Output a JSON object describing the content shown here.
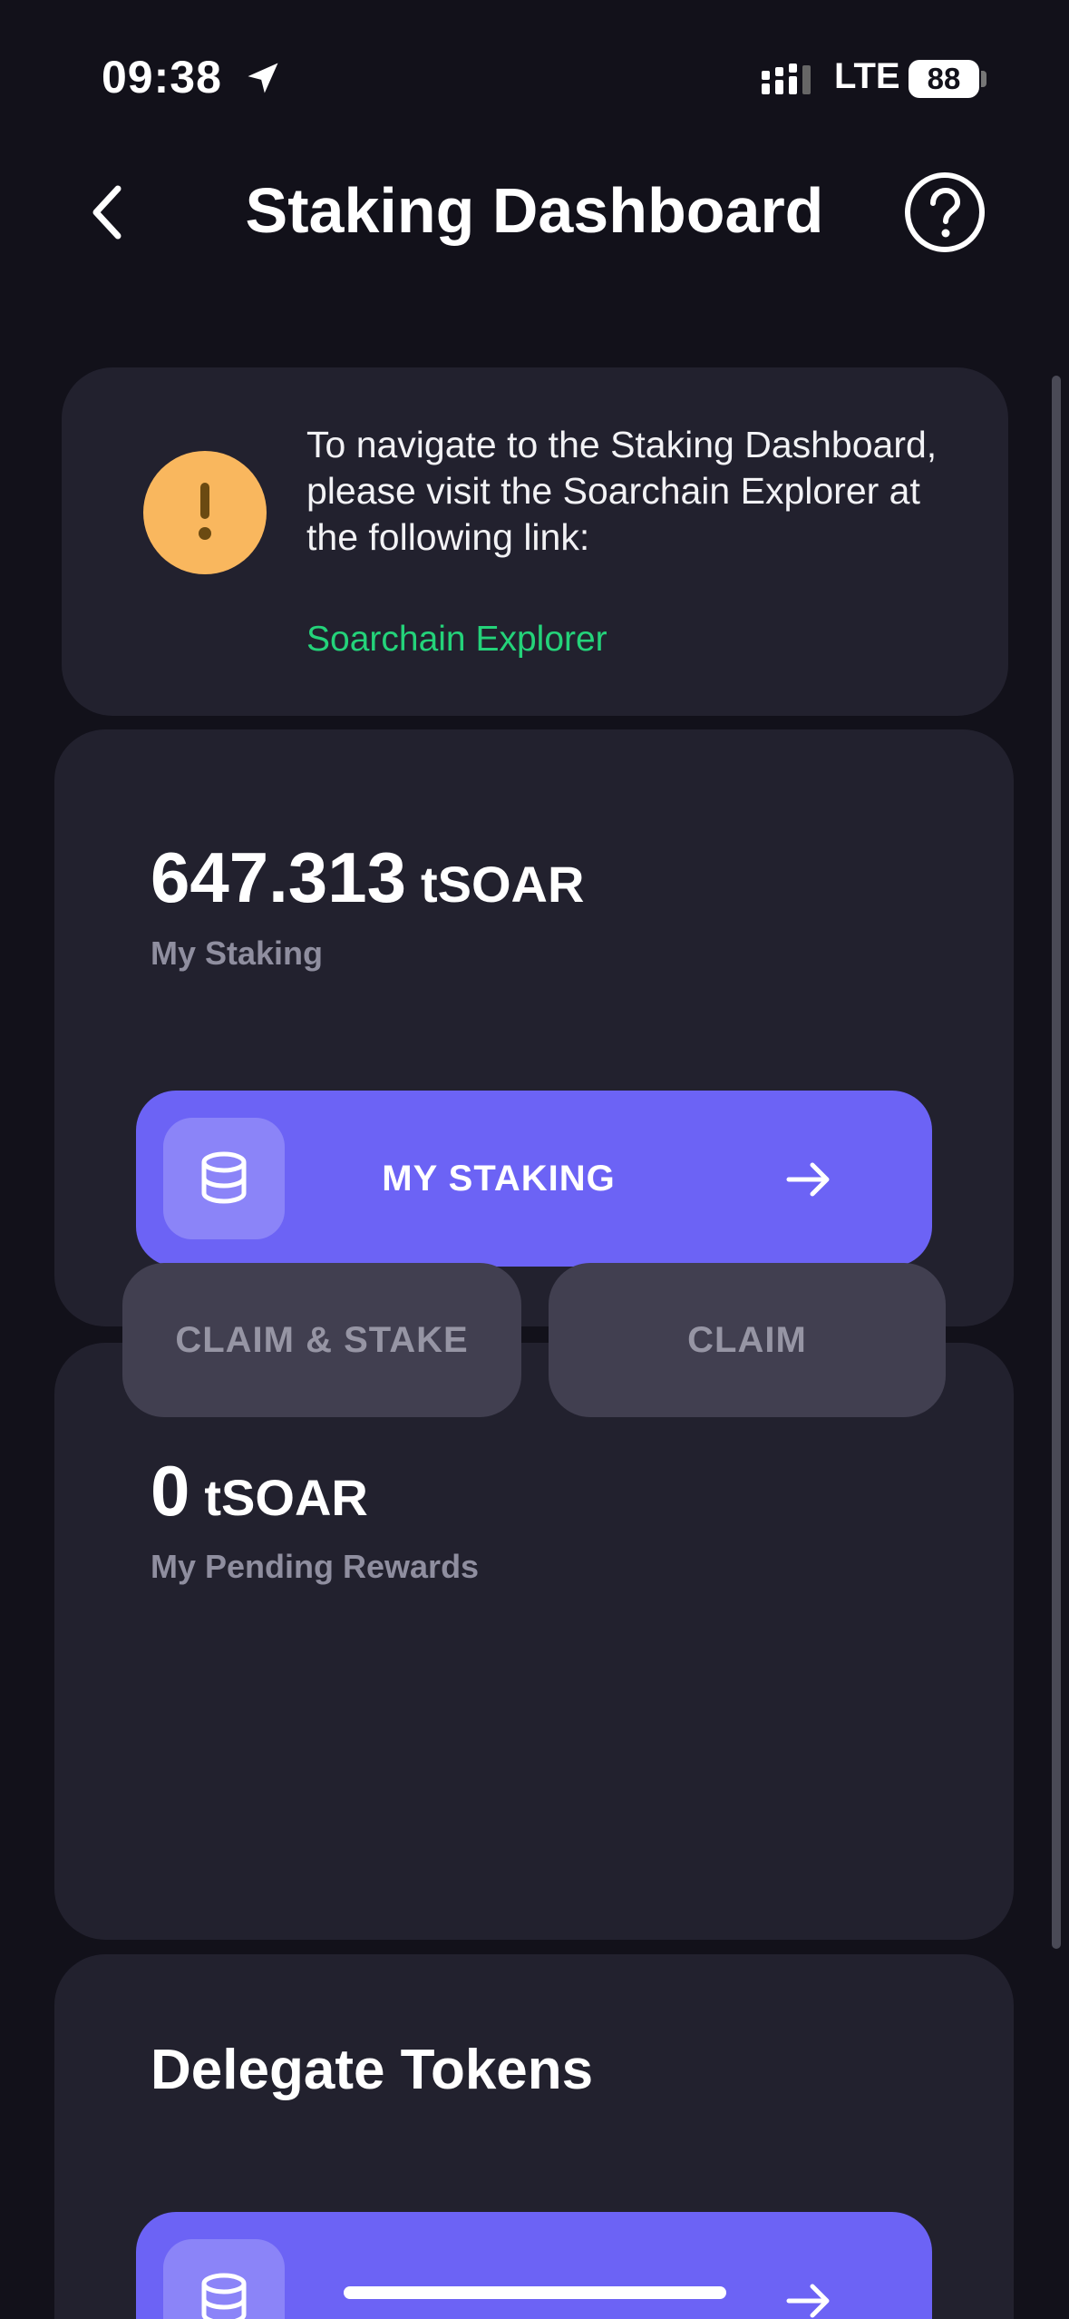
{
  "status_bar": {
    "time": "09:38",
    "network": "LTE",
    "battery": "88"
  },
  "header": {
    "title": "Staking Dashboard"
  },
  "notice": {
    "message": "To navigate to the Staking Dashboard, please visit the Soarchain Explorer at the following link:",
    "link_label": "Soarchain Explorer"
  },
  "staking": {
    "amount": "647.313",
    "unit": "tSOAR",
    "caption": "My Staking",
    "button_label": "MY STAKING"
  },
  "rewards": {
    "amount": "0",
    "unit": "tSOAR",
    "caption": "My Pending Rewards",
    "claim_stake_label": "CLAIM & STAKE",
    "claim_label": "CLAIM"
  },
  "delegate": {
    "title": "Delegate Tokens"
  },
  "colors": {
    "background": "#12111a",
    "card": "#22212e",
    "accent": "#6c63f5",
    "warning": "#f9b75e",
    "link": "#24d37a"
  }
}
